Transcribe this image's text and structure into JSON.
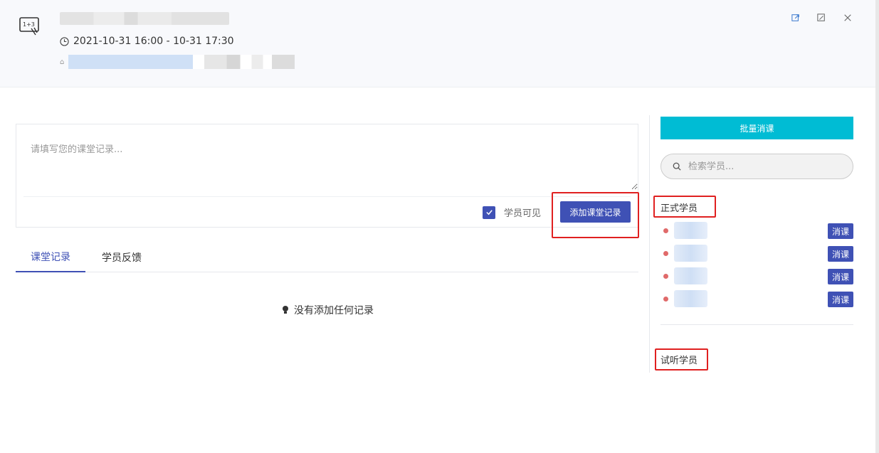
{
  "header": {
    "time_range": "2021-10-31 16:00 - 10-31 17:30"
  },
  "editor": {
    "placeholder": "请填写您的课堂记录...",
    "visible_label": "学员可见",
    "add_button": "添加课堂记录"
  },
  "tabs": [
    {
      "label": "课堂记录",
      "active": true
    },
    {
      "label": "学员反馈",
      "active": false
    }
  ],
  "empty_text": "没有添加任何记录",
  "right": {
    "batch_button": "批量消课",
    "search_placeholder": "检索学员...",
    "formal_title": "正式学员",
    "trial_title": "试听学员",
    "students": [
      {
        "action": "消课"
      },
      {
        "action": "消课"
      },
      {
        "action": "消课"
      },
      {
        "action": "消课"
      }
    ]
  },
  "colors": {
    "primary": "#3f51b5",
    "accent": "#00bcd4",
    "highlight": "#e02020",
    "status_dot": "#e06a6a"
  }
}
